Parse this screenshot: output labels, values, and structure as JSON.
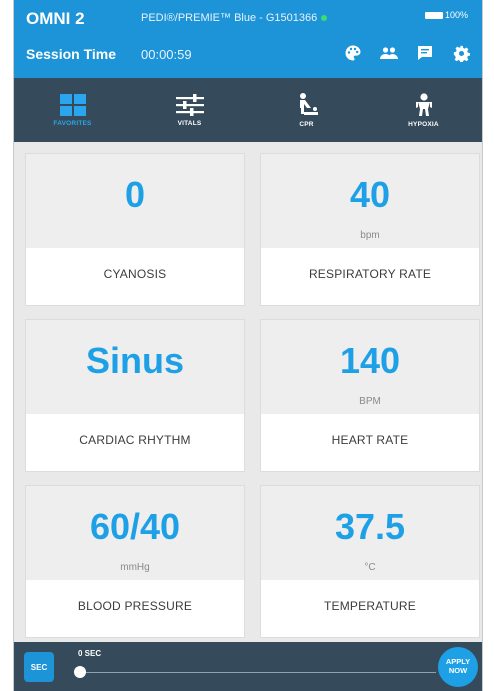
{
  "header": {
    "app_title": "OMNI 2",
    "device_info": "PEDI®/PREMIE™ Blue - G1501366",
    "battery": "100%",
    "session_label": "Session Time",
    "session_time": "00:00:59"
  },
  "tabs": [
    {
      "label": "FAVORITES",
      "icon": "grid-icon",
      "active": true
    },
    {
      "label": "VITALS",
      "icon": "sliders-icon",
      "active": false
    },
    {
      "label": "CPR",
      "icon": "cpr-icon",
      "active": false
    },
    {
      "label": "HYPOXIA",
      "icon": "baby-icon",
      "active": false
    }
  ],
  "cards": [
    {
      "value": "0",
      "unit": "",
      "label": "CYANOSIS"
    },
    {
      "value": "40",
      "unit": "bpm",
      "label": "RESPIRATORY RATE"
    },
    {
      "value": "Sinus",
      "unit": "",
      "label": "CARDIAC RHYTHM"
    },
    {
      "value": "140",
      "unit": "BPM",
      "label": "HEART RATE"
    },
    {
      "value": "60/40",
      "unit": "mmHg",
      "label": "BLOOD PRESSURE"
    },
    {
      "value": "37.5",
      "unit": "°C",
      "label": "TEMPERATURE"
    }
  ],
  "bottom": {
    "sec_button": "SEC",
    "slider_label": "0 SEC",
    "slider_value": 0,
    "apply_button": "APPLY\nNOW"
  },
  "colors": {
    "header_bg": "#1d93d8",
    "bar_bg": "#354a5a",
    "accent": "#1ea0e6",
    "status_dot": "#38e06a"
  }
}
